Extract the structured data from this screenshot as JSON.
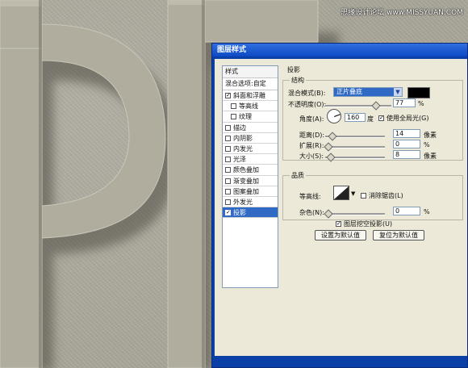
{
  "watermark": "思缘设计论坛 www.MISSYUAN.COM",
  "dialog": {
    "title": "图层样式",
    "style_list": {
      "header": "样式",
      "blend_options": "混合选项:自定",
      "items": [
        {
          "label": "斜面和浮雕",
          "checked": true,
          "sub": false,
          "selected": false
        },
        {
          "label": "等高线",
          "checked": false,
          "sub": true,
          "selected": false
        },
        {
          "label": "纹理",
          "checked": false,
          "sub": true,
          "selected": false
        },
        {
          "label": "描边",
          "checked": false,
          "sub": false,
          "selected": false
        },
        {
          "label": "内阴影",
          "checked": false,
          "sub": false,
          "selected": false
        },
        {
          "label": "内发光",
          "checked": false,
          "sub": false,
          "selected": false
        },
        {
          "label": "光泽",
          "checked": false,
          "sub": false,
          "selected": false
        },
        {
          "label": "颜色叠加",
          "checked": false,
          "sub": false,
          "selected": false
        },
        {
          "label": "渐变叠加",
          "checked": false,
          "sub": false,
          "selected": false
        },
        {
          "label": "图案叠加",
          "checked": false,
          "sub": false,
          "selected": false
        },
        {
          "label": "外发光",
          "checked": false,
          "sub": false,
          "selected": false
        },
        {
          "label": "投影",
          "checked": true,
          "sub": false,
          "selected": true
        }
      ]
    },
    "panel_title": "投影",
    "structure": {
      "title": "结构",
      "blend_mode_label": "混合模式(B):",
      "blend_mode_value": "正片叠底",
      "opacity_label": "不透明度(O):",
      "opacity_value": "77",
      "opacity_level": 0.77,
      "percent": "%",
      "angle_label": "角度(A):",
      "angle_value": "160",
      "degree": "度",
      "global_light_label": "使用全局光(G)",
      "global_light_checked": true,
      "distance_label": "距离(D):",
      "distance_value": "14",
      "pixel": "像素",
      "spread_label": "扩展(R):",
      "spread_value": "0",
      "size_label": "大小(S):",
      "size_value": "8"
    },
    "quality": {
      "title": "品质",
      "contour_label": "等高线:",
      "antialias_label": "消除锯齿(L)",
      "antialias_checked": false,
      "noise_label": "杂色(N):",
      "noise_value": "0"
    },
    "knockout_label": "图层挖空投影(U)",
    "knockout_checked": true,
    "set_default_button": "设置为默认值",
    "reset_default_button": "复位为默认值"
  }
}
